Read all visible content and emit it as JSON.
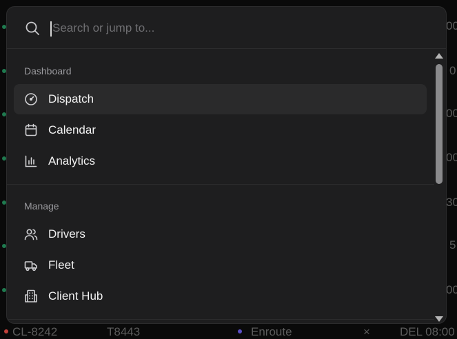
{
  "background": {
    "fragments": [
      {
        "id": "bg-frag-1",
        "text": "00"
      },
      {
        "id": "bg-frag-2",
        "text": "0"
      },
      {
        "id": "bg-frag-3",
        "text": "00"
      },
      {
        "id": "bg-frag-4",
        "text": "00"
      },
      {
        "id": "bg-frag-5",
        "text": "30"
      },
      {
        "id": "bg-frag-6",
        "text": "5"
      },
      {
        "id": "bg-frag-7",
        "text": "00"
      }
    ],
    "bottom_row": {
      "col1": "CL-8242",
      "col2": "T8443",
      "col3": "Enroute",
      "col4": "×",
      "col5": "DEL 08:00"
    },
    "dot_colors": {
      "green": "#1f7a4f",
      "purple": "#5b4fc6",
      "red": "#c2413b"
    }
  },
  "search": {
    "placeholder": "Search or jump to...",
    "value": "",
    "icon": "search-icon"
  },
  "sections": [
    {
      "label": "Dashboard",
      "items": [
        {
          "label": "Dispatch",
          "icon": "gauge-icon",
          "active": true
        },
        {
          "label": "Calendar",
          "icon": "calendar-icon",
          "active": false
        },
        {
          "label": "Analytics",
          "icon": "bar-chart-icon",
          "active": false
        }
      ]
    },
    {
      "label": "Manage",
      "items": [
        {
          "label": "Drivers",
          "icon": "users-icon",
          "active": false
        },
        {
          "label": "Fleet",
          "icon": "truck-icon",
          "active": false
        },
        {
          "label": "Client Hub",
          "icon": "building-icon",
          "active": false
        }
      ]
    }
  ],
  "colors": {
    "panel": "#1e1e1f",
    "active_row": "#2a2a2b",
    "text": "#f2f2f2",
    "muted": "#9a9a9e"
  }
}
